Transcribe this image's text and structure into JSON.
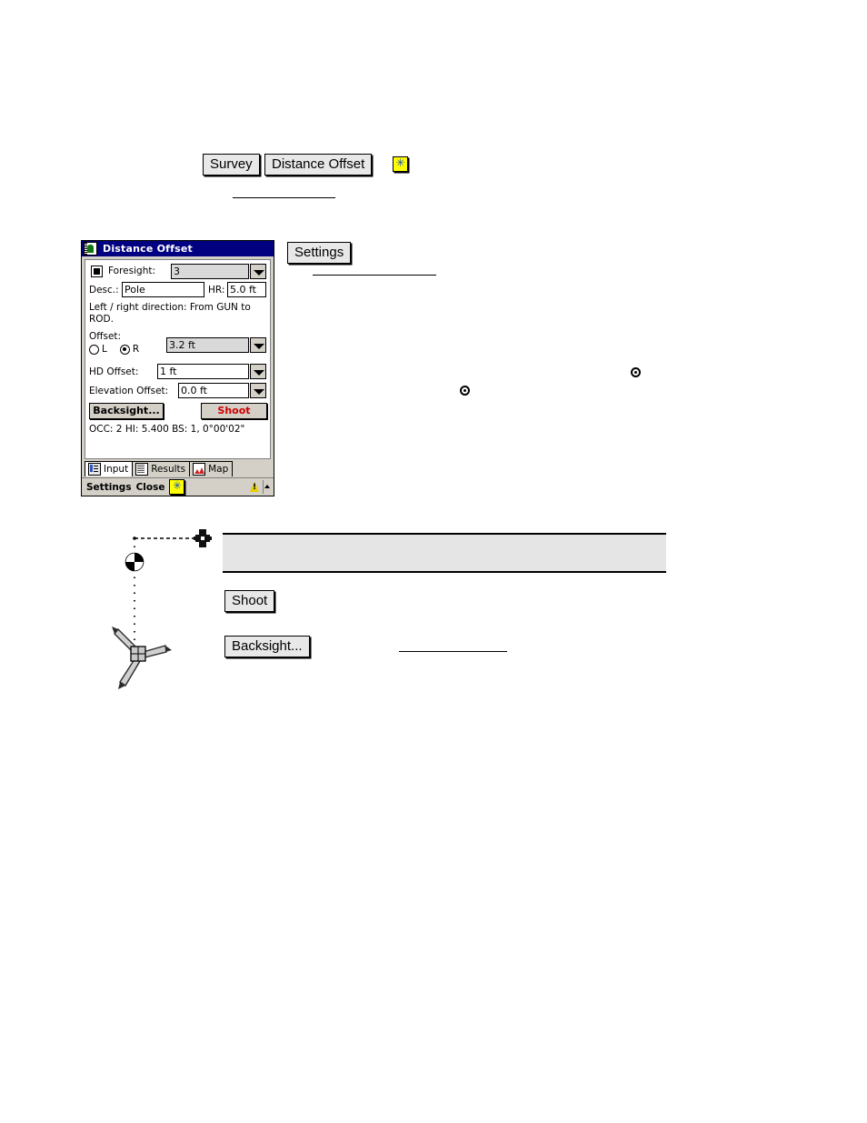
{
  "toolbar": {
    "survey_button": "Survey",
    "distance_offset_button": "Distance Offset",
    "star_icon": "yellow-star-icon",
    "star_glyph": "✳"
  },
  "settings_button": {
    "label": "Settings"
  },
  "dialog": {
    "title": "Distance Offset",
    "title_icon": "app-icon",
    "foresight": {
      "bullet_icon": "square-bullet-icon",
      "label": "Foresight:",
      "value": "3",
      "dropdown_icon": "chevron-down-icon"
    },
    "desc": {
      "label": "Desc.:",
      "value": "Pole"
    },
    "hr": {
      "label": "HR:",
      "value": "5.0 ft"
    },
    "note": "Left / right direction:  From GUN to ROD.",
    "offset": {
      "label": "Offset:",
      "radio_left_label": "L",
      "radio_right_label": "R",
      "selected": "R",
      "value": "3.2 ft",
      "dropdown_icon": "chevron-down-icon"
    },
    "hd_offset": {
      "label": "HD Offset:",
      "value": "1 ft",
      "dropdown_icon": "chevron-down-icon"
    },
    "elevation_offset": {
      "label": "Elevation Offset:",
      "value": "0.0 ft",
      "dropdown_icon": "chevron-down-icon"
    },
    "backsight_button": "Backsight...",
    "shoot_button": "Shoot",
    "shoot_color": "#cc0000",
    "status": "OCC: 2  HI: 5.400  BS: 1, 0°00'02\"",
    "tabs": [
      {
        "label": "Input",
        "icon": "input-form-icon",
        "active": true
      },
      {
        "label": "Results",
        "icon": "results-list-icon",
        "active": false
      },
      {
        "label": "Map",
        "icon": "map-icon",
        "active": false
      }
    ],
    "commandbar": {
      "settings": "Settings",
      "close": "Close",
      "star_icon": "yellow-star-icon",
      "star_glyph": "✳",
      "tray_icon": "warning-triangle-icon",
      "scroll_icon": "chevron-up-icon"
    }
  },
  "body_markers": {
    "radio_marker_a": "radio-selected-icon",
    "radio_marker_b": "radio-selected-icon"
  },
  "diagram": {
    "target_icon": "crosshair-target-icon",
    "prism_icon": "prism-point-icon",
    "instrument_icon": "tripod-instrument-icon",
    "offset_line_style": "dashed",
    "sight_line_style": "dotted"
  },
  "lower_buttons": {
    "shoot": "Shoot",
    "backsight": "Backsight..."
  },
  "highlight_box": {
    "text": ""
  }
}
